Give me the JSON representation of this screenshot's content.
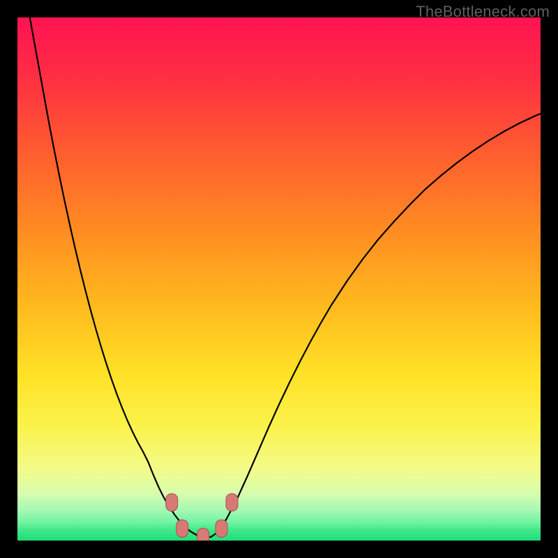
{
  "watermark": "TheBottleneck.com",
  "colors": {
    "bg": "#000000",
    "curve": "#000000",
    "marker_fill": "#d87a74",
    "marker_stroke": "#a85050",
    "gradient_stops": [
      {
        "offset": "0%",
        "color": "#ff1352"
      },
      {
        "offset": "10%",
        "color": "#ff2a45"
      },
      {
        "offset": "25%",
        "color": "#ff5a30"
      },
      {
        "offset": "40%",
        "color": "#ff8a22"
      },
      {
        "offset": "55%",
        "color": "#ffb91e"
      },
      {
        "offset": "68%",
        "color": "#ffe126"
      },
      {
        "offset": "78%",
        "color": "#fbf24a"
      },
      {
        "offset": "86%",
        "color": "#f4fb86"
      },
      {
        "offset": "91%",
        "color": "#d8fcae"
      },
      {
        "offset": "94%",
        "color": "#a9f9b4"
      },
      {
        "offset": "96.5%",
        "color": "#72f3a3"
      },
      {
        "offset": "98%",
        "color": "#3fe989"
      },
      {
        "offset": "100%",
        "color": "#1fdc7a"
      }
    ]
  },
  "chart_data": {
    "type": "line",
    "title": "",
    "xlabel": "",
    "ylabel": "",
    "xlim": [
      0,
      100
    ],
    "ylim": [
      0,
      100
    ],
    "x": [
      0,
      1,
      2,
      3,
      4,
      5,
      6,
      7,
      8,
      9,
      10,
      11,
      12,
      13,
      14,
      15,
      16,
      17,
      18,
      19,
      20,
      21,
      22,
      23,
      24,
      25,
      26,
      27,
      28,
      29,
      30,
      31,
      32,
      33,
      34,
      35,
      36,
      37,
      38,
      39,
      40,
      42,
      44,
      46,
      48,
      50,
      52,
      54,
      56,
      58,
      60,
      63,
      66,
      69,
      72,
      75,
      78,
      81,
      84,
      87,
      90,
      93,
      96,
      99,
      100
    ],
    "values": [
      114,
      108,
      102,
      96.5,
      91,
      85.5,
      80,
      74.8,
      69.8,
      65,
      60.4,
      56,
      51.8,
      47.8,
      44,
      40.4,
      37,
      33.8,
      30.8,
      28,
      25.4,
      23,
      20.8,
      18.8,
      17,
      15,
      12.5,
      10.2,
      8.2,
      6.5,
      5,
      3.7,
      2.6,
      1.8,
      1.2,
      0.7,
      0.5,
      0.7,
      1.4,
      2.6,
      4.2,
      8,
      12.4,
      17,
      21.6,
      26,
      30.2,
      34.2,
      38,
      41.6,
      45,
      49.6,
      53.8,
      57.6,
      61,
      64.2,
      67.2,
      69.8,
      72.2,
      74.4,
      76.4,
      78.2,
      79.8,
      81.2,
      81.6
    ],
    "markers": [
      {
        "x": 29.5,
        "y": 7.3
      },
      {
        "x": 31.5,
        "y": 2.3
      },
      {
        "x": 35.5,
        "y": 0.7
      },
      {
        "x": 39.0,
        "y": 2.3
      },
      {
        "x": 41.0,
        "y": 7.3
      }
    ],
    "legend": false
  }
}
